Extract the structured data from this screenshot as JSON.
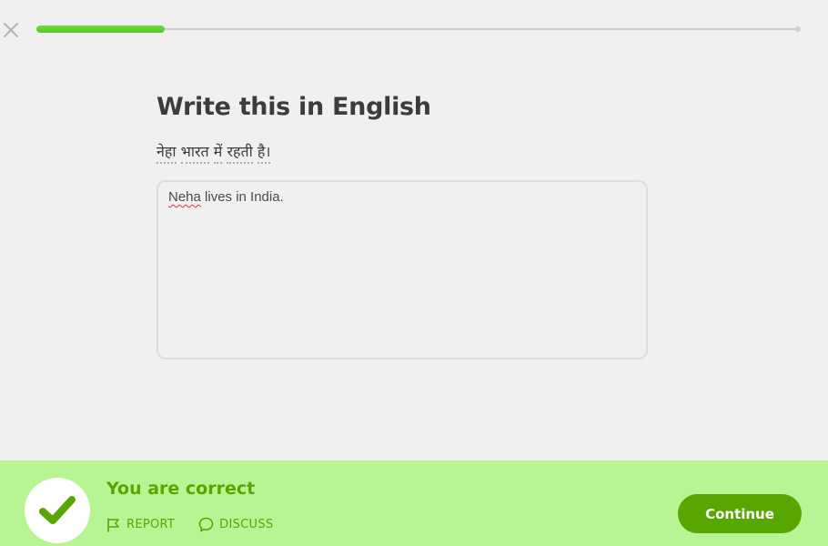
{
  "header": {
    "close_icon": "close-icon",
    "progress_fraction": 0.168
  },
  "main": {
    "title": "Write this in English",
    "prompt_words": [
      "नेहा",
      "भारत",
      "में",
      "रहती",
      "है।"
    ],
    "answer": {
      "misspelled_word": "Neha",
      "rest": " lives in India."
    }
  },
  "feedback": {
    "status_icon": "check-icon",
    "title": "You are correct",
    "report_label": "REPORT",
    "report_icon": "flag-icon",
    "discuss_label": "DISCUSS",
    "discuss_icon": "speech-bubble-icon",
    "continue_label": "Continue"
  },
  "colors": {
    "progress": "#58cc02",
    "feedback_background": "#b6f494",
    "feedback_text": "#58a700",
    "continue_button": "#58a700"
  }
}
